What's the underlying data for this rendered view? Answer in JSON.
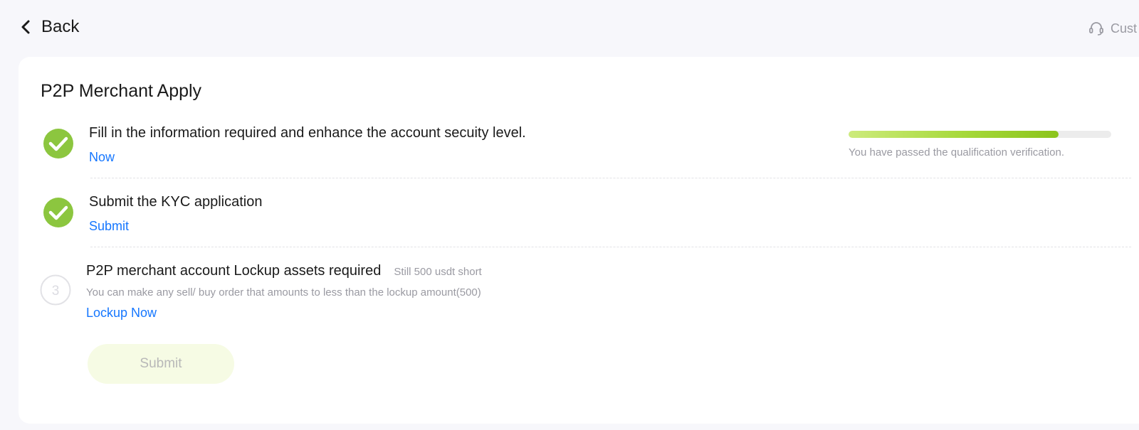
{
  "nav": {
    "back_label": "Back",
    "customer_service_label": "Cust"
  },
  "page": {
    "title": "P2P Merchant Apply"
  },
  "steps": [
    {
      "number": "1",
      "status": "completed",
      "title": "Fill in the information required and enhance the account secuity level.",
      "link": "Now"
    },
    {
      "number": "2",
      "status": "completed",
      "title": "Submit the KYC application",
      "link": "Submit"
    },
    {
      "number": "3",
      "status": "pending",
      "title": "P2P merchant account Lockup assets required",
      "note": "Still 500 usdt short",
      "description": "You can make any sell/ buy order that amounts to less than the lockup amount(500)",
      "link": "Lockup Now"
    }
  ],
  "progress": {
    "percent": 80,
    "text": "You have passed the qualification verification."
  },
  "submit_button": {
    "label": "Submit",
    "disabled": true
  },
  "colors": {
    "accent_green": "#8cc63f",
    "link_blue": "#1677ff",
    "muted_text": "#9a9aa2",
    "disabled_button_bg": "#f6fbe4"
  },
  "icons": {
    "back": "chevron-left-icon",
    "customer_service": "headset-icon",
    "step_done": "check-circle-icon",
    "step_pending": "number-circle-icon"
  }
}
